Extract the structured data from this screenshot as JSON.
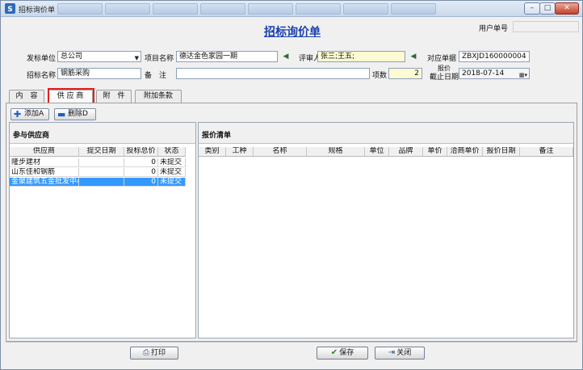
{
  "window": {
    "title": "招标询价单",
    "controls": {
      "minimize": "–",
      "maximize": "□",
      "close": "✕"
    }
  },
  "header": {
    "page_title": "招标询价单",
    "user_no_label": "用户单号",
    "user_no_value": ""
  },
  "form": {
    "issuer_label": "发标单位",
    "issuer_value": "总公司",
    "project_label": "项目名称",
    "project_value": "德达金色家园一期",
    "reviewer_label": "评审人",
    "reviewer_value": "张三;王五;",
    "ref_label": "对应单据",
    "ref_value": "ZBXJD160000004",
    "bid_name_label": "招标名称",
    "bid_name_value": "钢筋采购",
    "remark_label": "备　注",
    "remark_value": "",
    "items_label": "项数",
    "items_value": "2",
    "deadline_label_1": "报价",
    "deadline_label_2": "截止日期",
    "deadline_value": "2018-07-14"
  },
  "tabs": [
    {
      "label": "内　容"
    },
    {
      "label": "供 应 商"
    },
    {
      "label": "附　件"
    },
    {
      "label": "附加条款"
    }
  ],
  "toolbar": {
    "add_label": "添加A",
    "delete_label": "删除D"
  },
  "suppliers": {
    "title": "参与供应商",
    "columns": [
      "供应商",
      "提交日期",
      "投标总价",
      "状态"
    ],
    "rows": [
      {
        "name": "隆步建材",
        "date": "",
        "total": "0",
        "status": "未提交"
      },
      {
        "name": "山东佳和钢筋",
        "date": "",
        "total": "0",
        "status": "未提交"
      },
      {
        "name": "金聚建筑五金批发中心",
        "date": "",
        "total": "0",
        "status": "未提交"
      }
    ]
  },
  "quote": {
    "title": "报价清单",
    "columns": [
      "类别",
      "工种",
      "名称",
      "规格",
      "单位",
      "品牌",
      "单价",
      "洽商单价",
      "报价日期",
      "备注"
    ]
  },
  "actions": {
    "print_label": "打印",
    "save_label": "保存",
    "close_label": "关闭"
  },
  "colors": {
    "title_blue": "#1a3fb0",
    "selected_row": "#3399ff",
    "highlight_red": "#e02020",
    "reviewer_field": "#fdfbd3"
  }
}
